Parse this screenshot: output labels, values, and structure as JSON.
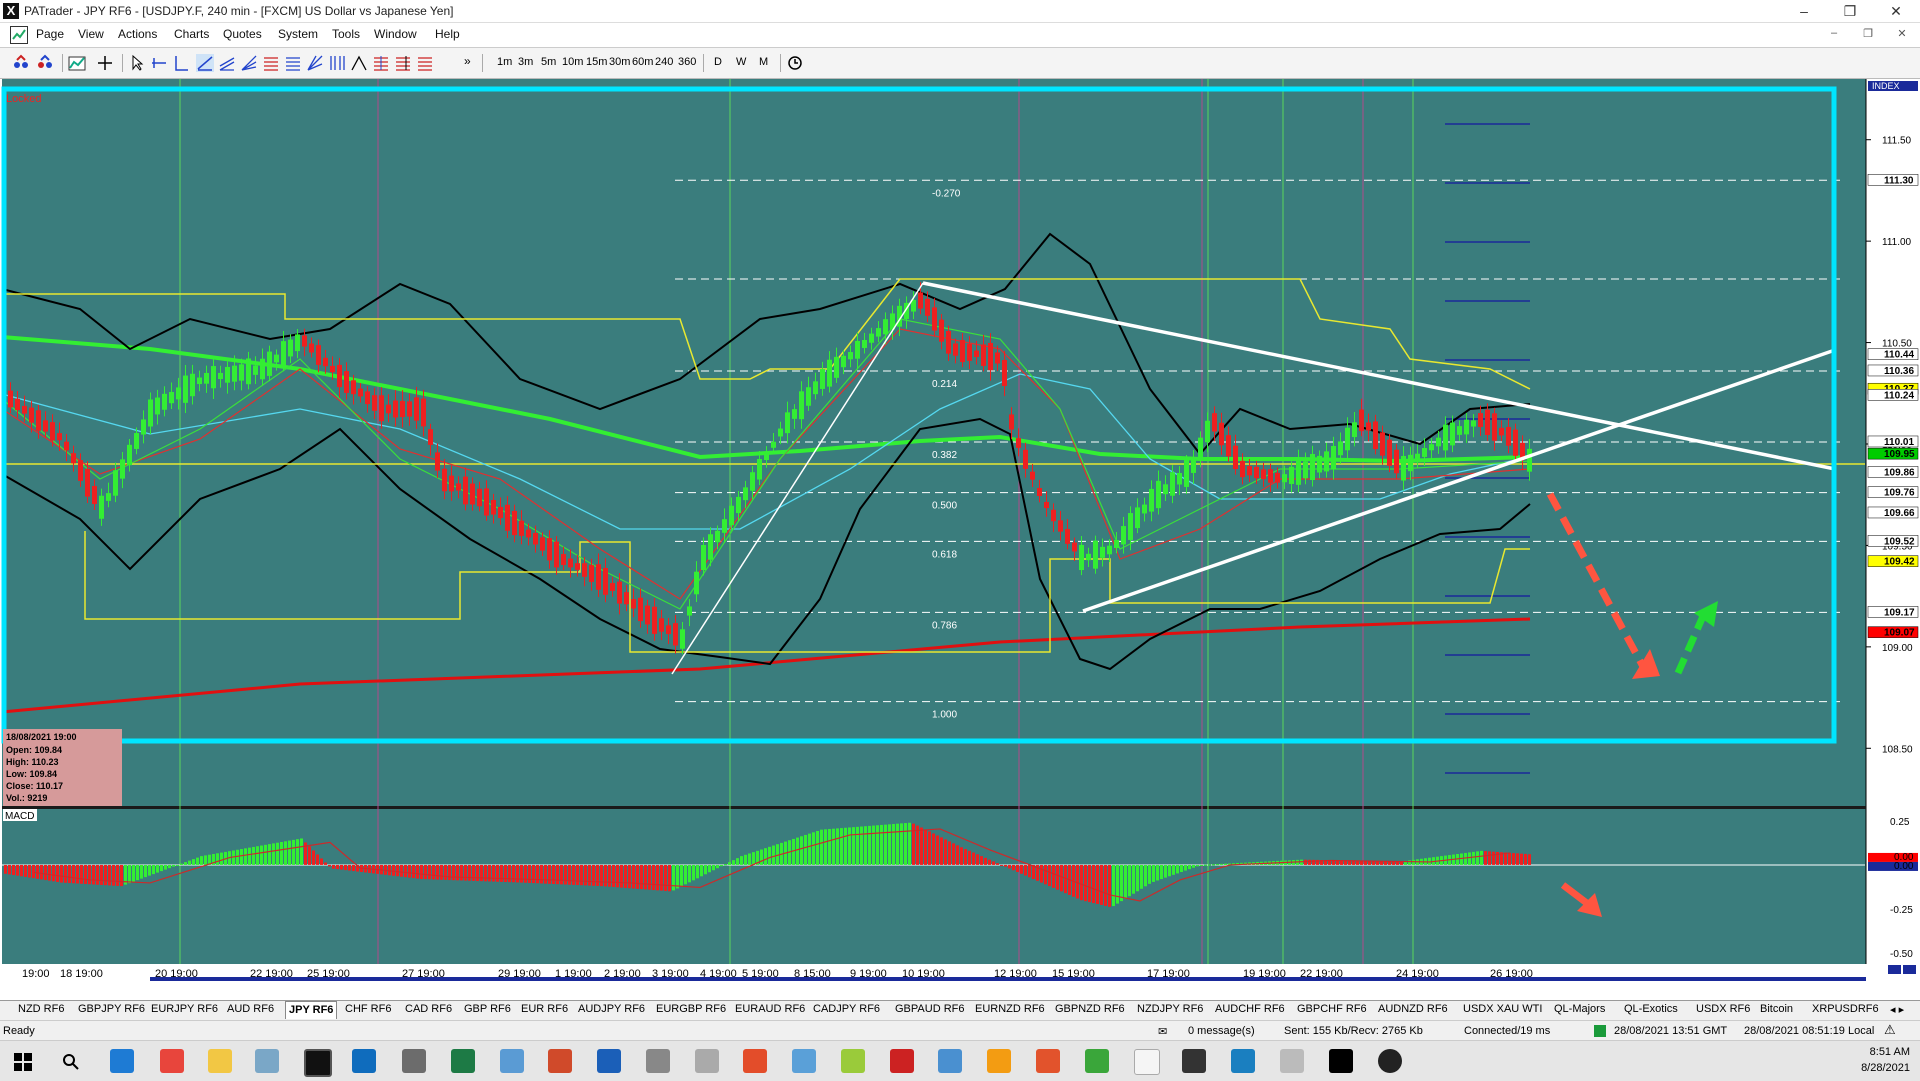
{
  "window": {
    "title": "PATrader - JPY RF6 - [USDJPY.F, 240 min - [FXCM] US Dollar vs Japanese Yen]"
  },
  "menu": [
    "Page",
    "View",
    "Actions",
    "Charts",
    "Quotes",
    "System",
    "Tools",
    "Window",
    "Help"
  ],
  "toolbar": {
    "timeframes": [
      "1m",
      "3m",
      "5m",
      "10m",
      "15m",
      "30m",
      "60m",
      "240",
      "360",
      "D",
      "W",
      "M"
    ],
    "overflow": "»"
  },
  "chart": {
    "locked_label": "Locked",
    "index_label": "INDEX",
    "macd_label": "MACD",
    "fib_levels": [
      {
        "label": "-0.270",
        "price": 111.3
      },
      {
        "label": "0.214",
        "price": 110.36
      },
      {
        "label": "0.382",
        "price": 110.01
      },
      {
        "label": "0.500",
        "price": 109.76
      },
      {
        "label": "0.618",
        "price": 109.52
      },
      {
        "label": "0.786",
        "price": 109.17
      },
      {
        "label": "1.000",
        "price": 108.73
      }
    ],
    "price_axis": {
      "ticks": [
        "111.50",
        "111.00",
        "110.50",
        "110.00",
        "109.50",
        "109.00",
        "108.50"
      ],
      "tick_values": [
        111.5,
        111.0,
        110.5,
        110.0,
        109.5,
        109.0,
        108.5
      ],
      "level_labels": [
        {
          "text": "111.30",
          "value": 111.3,
          "bg": "#ffffff"
        },
        {
          "text": "110.44",
          "value": 110.44,
          "bg": "#ffffff"
        },
        {
          "text": "110.36",
          "value": 110.36,
          "bg": "#ffffff"
        },
        {
          "text": "110.27",
          "value": 110.27,
          "bg": "#ffff00"
        },
        {
          "text": "110.24",
          "value": 110.24,
          "bg": "#ffffff"
        },
        {
          "text": "110.01",
          "value": 110.01,
          "bg": "#ffffff"
        },
        {
          "text": "109.95",
          "value": 109.95,
          "bg": "#00cc00"
        },
        {
          "text": "109.86",
          "value": 109.86,
          "bg": "#ffffff"
        },
        {
          "text": "109.76",
          "value": 109.76,
          "bg": "#ffffff"
        },
        {
          "text": "109.66",
          "value": 109.66,
          "bg": "#ffffff"
        },
        {
          "text": "109.52",
          "value": 109.52,
          "bg": "#ffffff"
        },
        {
          "text": "109.42",
          "value": 109.42,
          "bg": "#ffff00"
        },
        {
          "text": "109.17",
          "value": 109.17,
          "bg": "#ffffff"
        },
        {
          "text": "109.07",
          "value": 109.07,
          "bg": "#ff0000"
        }
      ],
      "range": [
        108.25,
        111.75
      ]
    },
    "macd_axis": {
      "ticks": [
        "0.25",
        "-0.25",
        "-0.50"
      ],
      "tick_values": [
        0.25,
        -0.25,
        -0.5
      ],
      "zero_labels": [
        "0.00",
        "0.00"
      ],
      "range": [
        -0.55,
        0.3
      ]
    },
    "time_axis": [
      "19:00",
      "18 19:00",
      "20 19:00",
      "22 19:00",
      "25 19:00",
      "27 19:00",
      "29 19:00",
      "1 19:00",
      "2 19:00",
      "3 19:00",
      "4 19:00",
      "5 19:00",
      "8 15:00",
      "9 19:00",
      "10 19:00",
      "12 19:00",
      "15 19:00",
      "17 19:00",
      "19 19:00",
      "22 19:00",
      "24 19:00",
      "26 19:00"
    ],
    "info_box": {
      "date": "18/08/2021 19:00",
      "open": "Open: 109.84",
      "high": "High: 110.23",
      "low": "Low: 109.84",
      "close": "Close: 110.17",
      "vol": "Vol.: 9219"
    }
  },
  "chart_data": {
    "type": "candlestick",
    "symbol": "USDJPY.F",
    "timeframe": "240 min",
    "ylim": [
      108.25,
      111.75
    ],
    "macd_ylim": [
      -0.55,
      0.3
    ],
    "colors": {
      "bull": "#33ee33",
      "bear": "#ee2020",
      "background": "#3a7d7d",
      "frame": "#00e5ff"
    }
  },
  "tabs": [
    "NZD RF6",
    "GBPJPY RF6",
    "EURJPY RF6",
    "AUD RF6",
    "JPY RF6",
    "CHF RF6",
    "CAD RF6",
    "GBP RF6",
    "EUR RF6",
    "AUDJPY RF6",
    "EURGBP RF6",
    "EURAUD RF6",
    "CADJPY RF6",
    "GBPAUD RF6",
    "EURNZD RF6",
    "GBPNZD RF6",
    "NZDJPY RF6",
    "AUDCHF RF6",
    "GBPCHF RF6",
    "AUDNZD RF6",
    "USDX XAU WTI",
    "QL-Majors",
    "QL-Exotics",
    "USDX RF6",
    "Bitcoin",
    "XRPUSDRF6"
  ],
  "active_tab": "JPY RF6",
  "status": {
    "ready": "Ready",
    "messages": "0 message(s)",
    "traffic": "Sent: 155 Kb/Recv: 2765 Kb",
    "connection": "Connected/19 ms",
    "gmt": "28/08/2021 13:51 GMT",
    "local": "28/08/2021 08:51:19 Local"
  },
  "taskbar": {
    "time": "8:51 AM",
    "date": "8/28/2021"
  }
}
